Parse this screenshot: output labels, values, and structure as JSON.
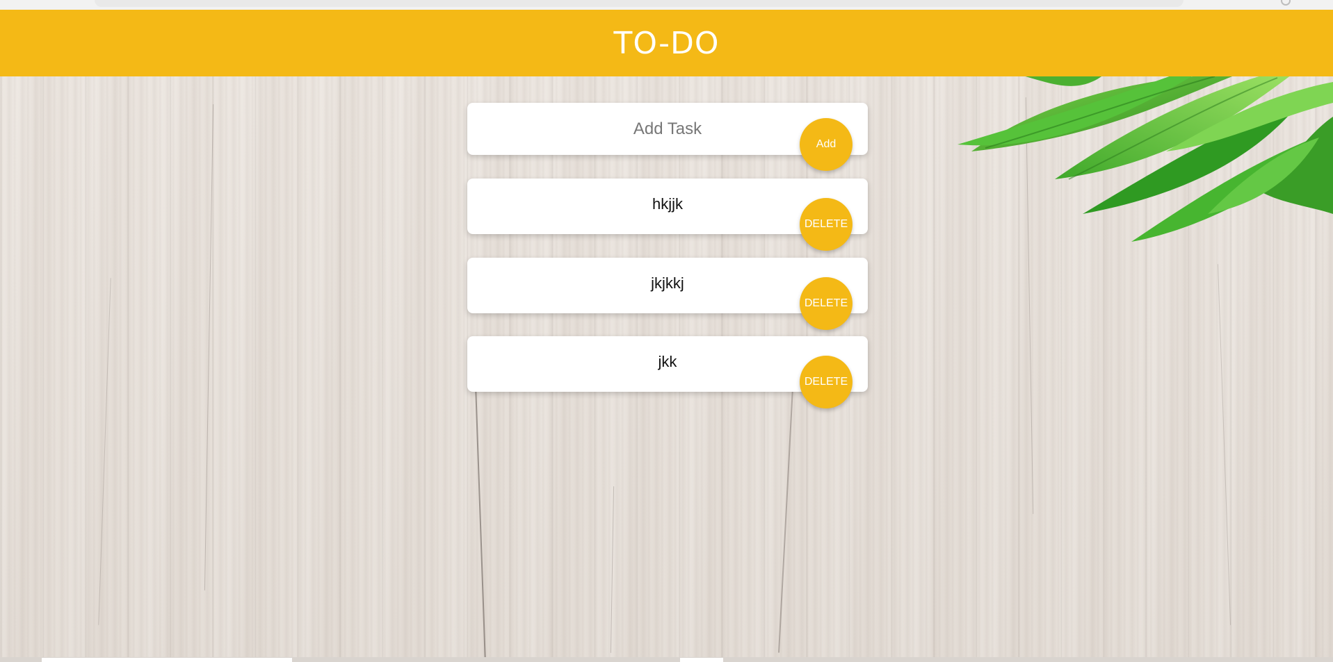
{
  "header": {
    "title": "TO-DO"
  },
  "add_task": {
    "placeholder": "Add Task",
    "button_label": "Add"
  },
  "tasks": [
    {
      "text": "hkjjk",
      "delete_label": "DELETE"
    },
    {
      "text": "jkjkkj",
      "delete_label": "DELETE"
    },
    {
      "text": "jkk",
      "delete_label": "DELETE"
    }
  ],
  "colors": {
    "accent": "#f4b916",
    "card": "#ffffff",
    "button_text": "#ffffff"
  },
  "icons": [
    "leaves-decoration"
  ]
}
